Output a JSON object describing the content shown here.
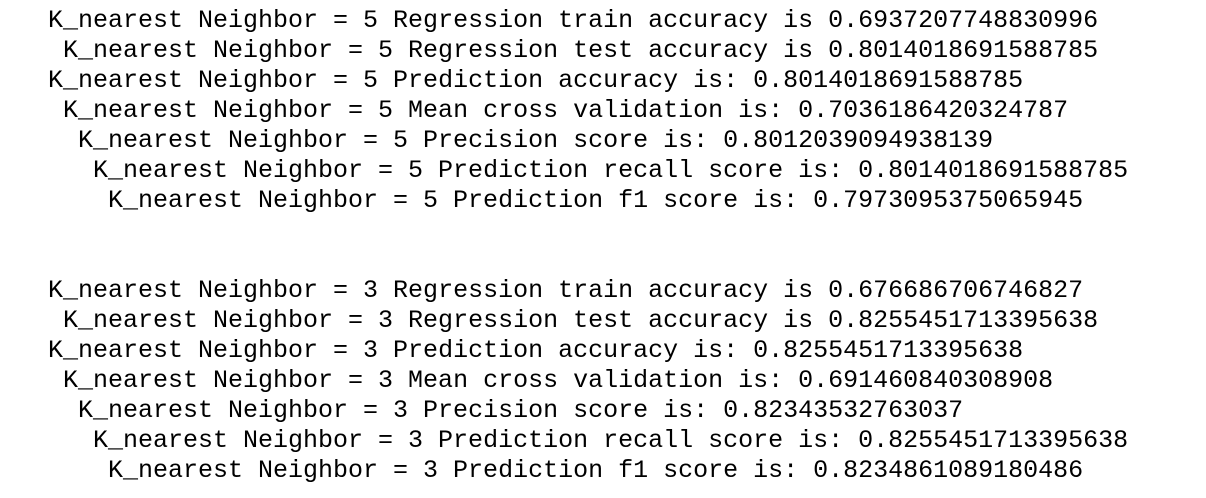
{
  "output": {
    "blocks": [
      {
        "lines": [
          "K_nearest Neighbor = 5 Regression train accuracy is 0.6937207748830996",
          "K_nearest Neighbor = 5 Regression test accuracy is 0.8014018691588785",
          "K_nearest Neighbor = 5 Prediction accuracy is: 0.8014018691588785",
          "K_nearest Neighbor = 5 Mean cross validation is: 0.7036186420324787",
          "K_nearest Neighbor = 5 Precision score is: 0.8012039094938139",
          "K_nearest Neighbor = 5 Prediction recall score is: 0.8014018691588785",
          "K_nearest Neighbor = 5 Prediction f1 score is: 0.7973095375065945"
        ]
      },
      {
        "lines": [
          "K_nearest Neighbor = 3 Regression train accuracy is 0.676686706746827",
          "K_nearest Neighbor = 3 Regression test accuracy is 0.8255451713395638",
          "K_nearest Neighbor = 3 Prediction accuracy is: 0.8255451713395638",
          "K_nearest Neighbor = 3 Mean cross validation is: 0.691460840308908",
          "K_nearest Neighbor = 3 Precision score is: 0.82343532763037",
          "K_nearest Neighbor = 3 Prediction recall score is: 0.8255451713395638",
          "K_nearest Neighbor = 3 Prediction f1 score is: 0.8234861089180486"
        ]
      }
    ]
  }
}
